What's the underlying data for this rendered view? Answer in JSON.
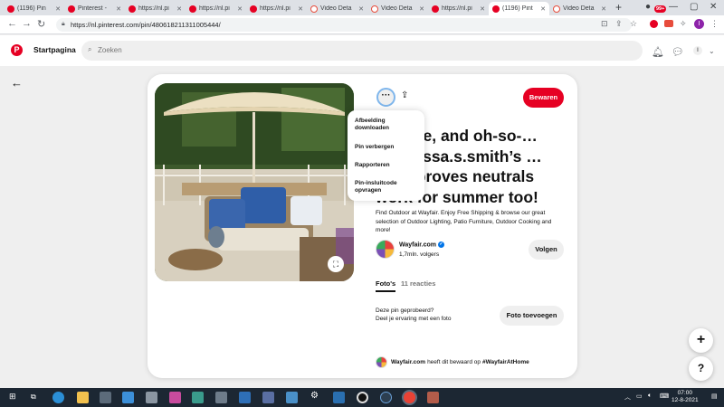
{
  "tabs": [
    {
      "label": "(1196) Pin",
      "icon": "pinterest-icon",
      "active": false
    },
    {
      "label": "Pinterest -",
      "icon": "pinterest-icon",
      "active": false
    },
    {
      "label": "https://nl.pi",
      "icon": "pinterest-icon",
      "active": false
    },
    {
      "label": "https://nl.pi",
      "icon": "pinterest-icon",
      "active": false
    },
    {
      "label": "https://nl.pi",
      "icon": "pinterest-icon",
      "active": false
    },
    {
      "label": "Video Deta",
      "icon": "video-icon",
      "active": false
    },
    {
      "label": "Video Deta",
      "icon": "video-icon",
      "active": false
    },
    {
      "label": "https://nl.pi",
      "icon": "pinterest-icon",
      "active": false
    },
    {
      "label": "(1196) Pint",
      "icon": "pinterest-icon",
      "active": true
    },
    {
      "label": "Video Deta",
      "icon": "video-icon",
      "active": false
    }
  ],
  "browser": {
    "url": "https://nl.pinterest.com/pin/480618211311005444/"
  },
  "header": {
    "home_label": "Startpagina",
    "search_placeholder": "Zoeken",
    "notification_count": "99+",
    "profile_initial": "I"
  },
  "pin": {
    "menu_items": [
      "Afbeelding downloaden",
      "Pin verbergen",
      "Rapporteren",
      "Pin-insluitcode opvragen"
    ],
    "save_label": "Bewaren",
    "title": "…white, and oh-so-… @melissa.s.smith’s … deck proves neutrals work for summer too!",
    "description": "Find Outdoor at Wayfair. Enjoy Free Shipping & browse our great selection of Outdoor Lighting, Patio Furniture, Outdoor Cooking and more!",
    "creator_name": "Wayfair.com",
    "followers": "1,7mln. volgers",
    "follow_label": "Volgen",
    "tab_photos": "Foto's",
    "tab_comments": "11 reacties",
    "tried_line1": "Deze pin geprobeerd?",
    "tried_line2": "Deel je ervaring met een foto",
    "add_photo_label": "Foto toevoegen",
    "saved_by_name": "Wayfair.com",
    "saved_by_text": "heeft dit bewaard op",
    "saved_by_board": "#WayfairAtHome"
  },
  "fab": {
    "plus": "+",
    "help": "?"
  },
  "clock": {
    "time": "07:00",
    "date": "12-8-2021"
  },
  "colors": {
    "pinterest_red": "#e60023",
    "taskbar": "#1c2733"
  }
}
